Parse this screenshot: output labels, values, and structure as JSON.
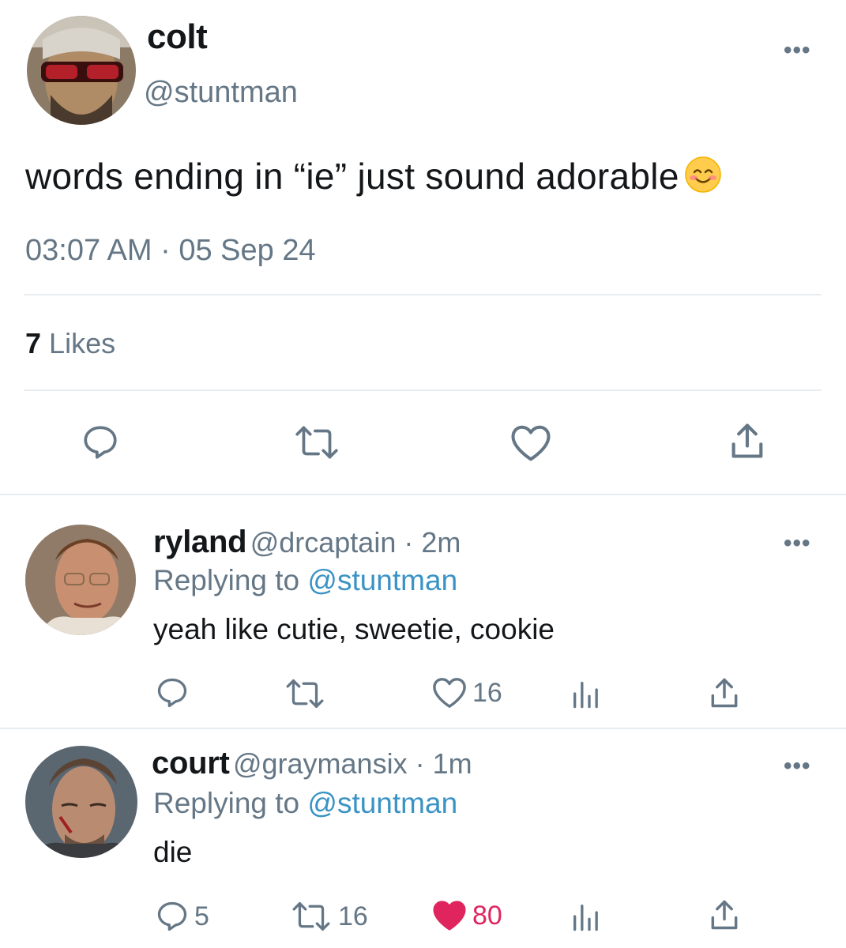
{
  "main_tweet": {
    "name": "colt",
    "handle": "@stuntman",
    "text": "words ending in “ie” just sound adorable",
    "emoji_icon": "smiling-face-icon",
    "timestamp": "03:07 AM · 05 Sep 24",
    "likes_count": "7",
    "likes_label": "Likes"
  },
  "replies": [
    {
      "name": "ryland",
      "meta": "@drcaptain · 2m",
      "replying_label": "Replying to",
      "replying_handle": "@stuntman",
      "text": "yeah like cutie, sweetie, cookie",
      "reply_count": "",
      "retweet_count": "",
      "like_count": "16",
      "liked": false
    },
    {
      "name": "court",
      "meta": "@graymansix · 1m",
      "replying_label": "Replying to",
      "replying_handle": "@stuntman",
      "text": "die",
      "reply_count": "5",
      "retweet_count": "16",
      "like_count": "80",
      "liked": true
    }
  ],
  "colors": {
    "text": "#14171a",
    "secondary": "#657786",
    "link": "#3a93c4",
    "like_red": "#e0245e",
    "divider": "#e6ecf0"
  }
}
